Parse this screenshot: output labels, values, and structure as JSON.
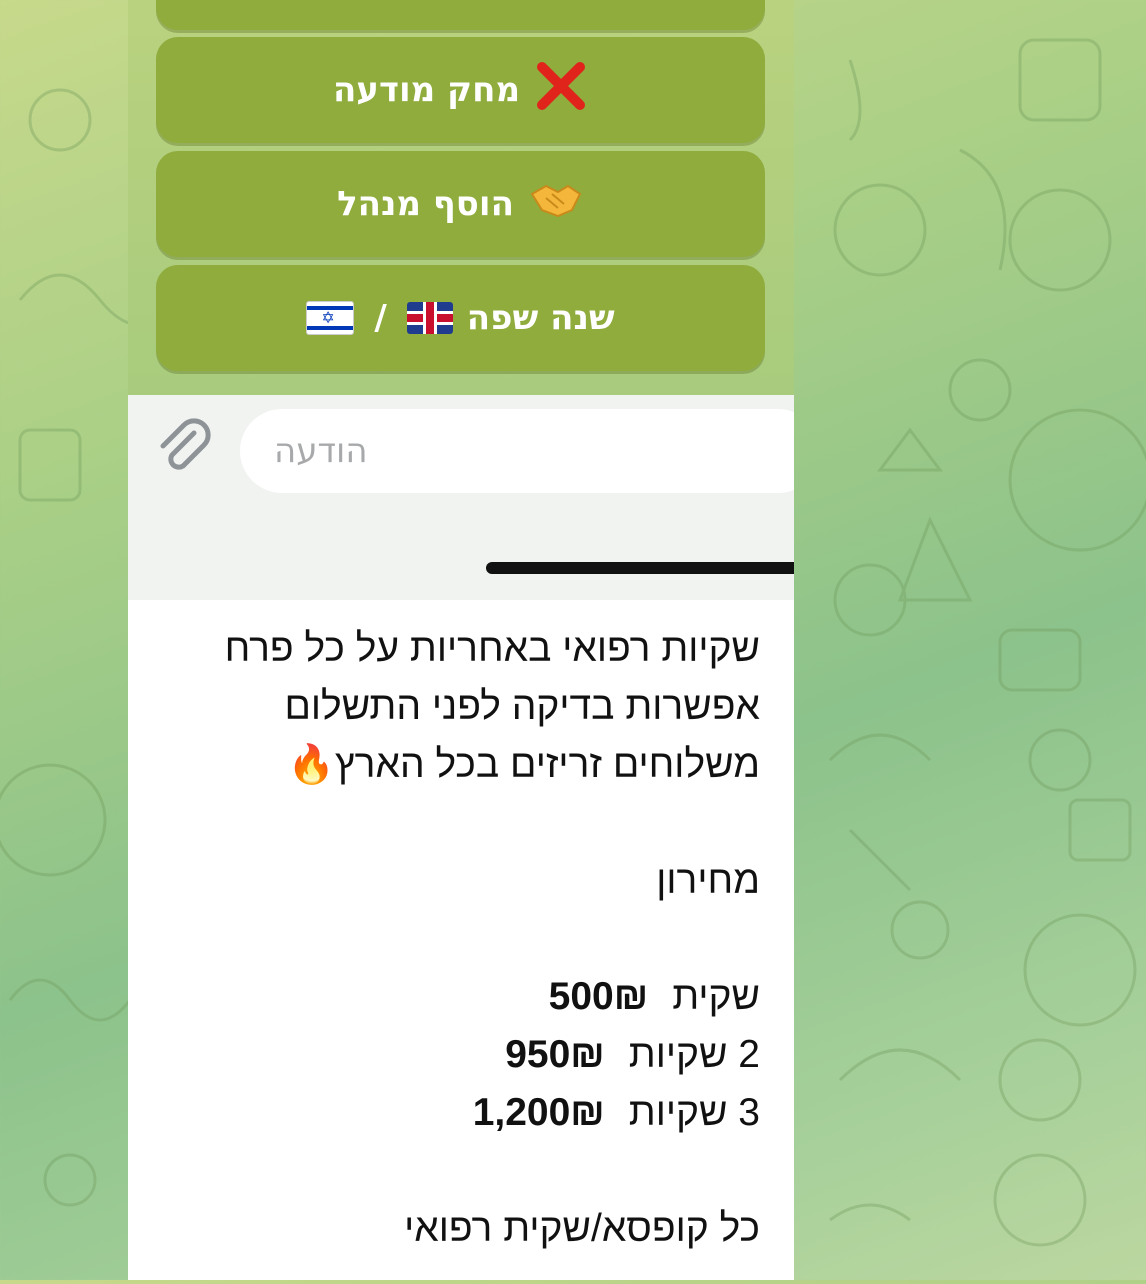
{
  "keyboard": {
    "delete_message": {
      "label": "מחק מודעה",
      "icon": "red-x-icon"
    },
    "add_admin": {
      "label": "הוסף מנהל",
      "icon": "handshake-icon"
    },
    "change_language": {
      "label": "שנה שפה",
      "separator": "/",
      "flags": [
        "uk-flag-icon",
        "israel-flag-icon"
      ]
    }
  },
  "composer": {
    "placeholder": "הודעה"
  },
  "post": {
    "lines": [
      "שקיות רפואי באחריות על כל פרח",
      "אפשרות בדיקה לפני התשלום",
      "משלוחים זריזים בכל הארץ"
    ],
    "pricelist_title": "מחירון",
    "prices": [
      {
        "label": "שקית",
        "value": "500₪"
      },
      {
        "label": "2 שקיות",
        "value": "950₪"
      },
      {
        "label": "3 שקיות",
        "value": "1,200₪"
      }
    ],
    "footer": "כל קופסא/שקית רפואי"
  },
  "colors": {
    "keyboard_button": "#8fac3d",
    "chat_background": "#b9d27f",
    "input_bar": "#f1f3f0"
  }
}
